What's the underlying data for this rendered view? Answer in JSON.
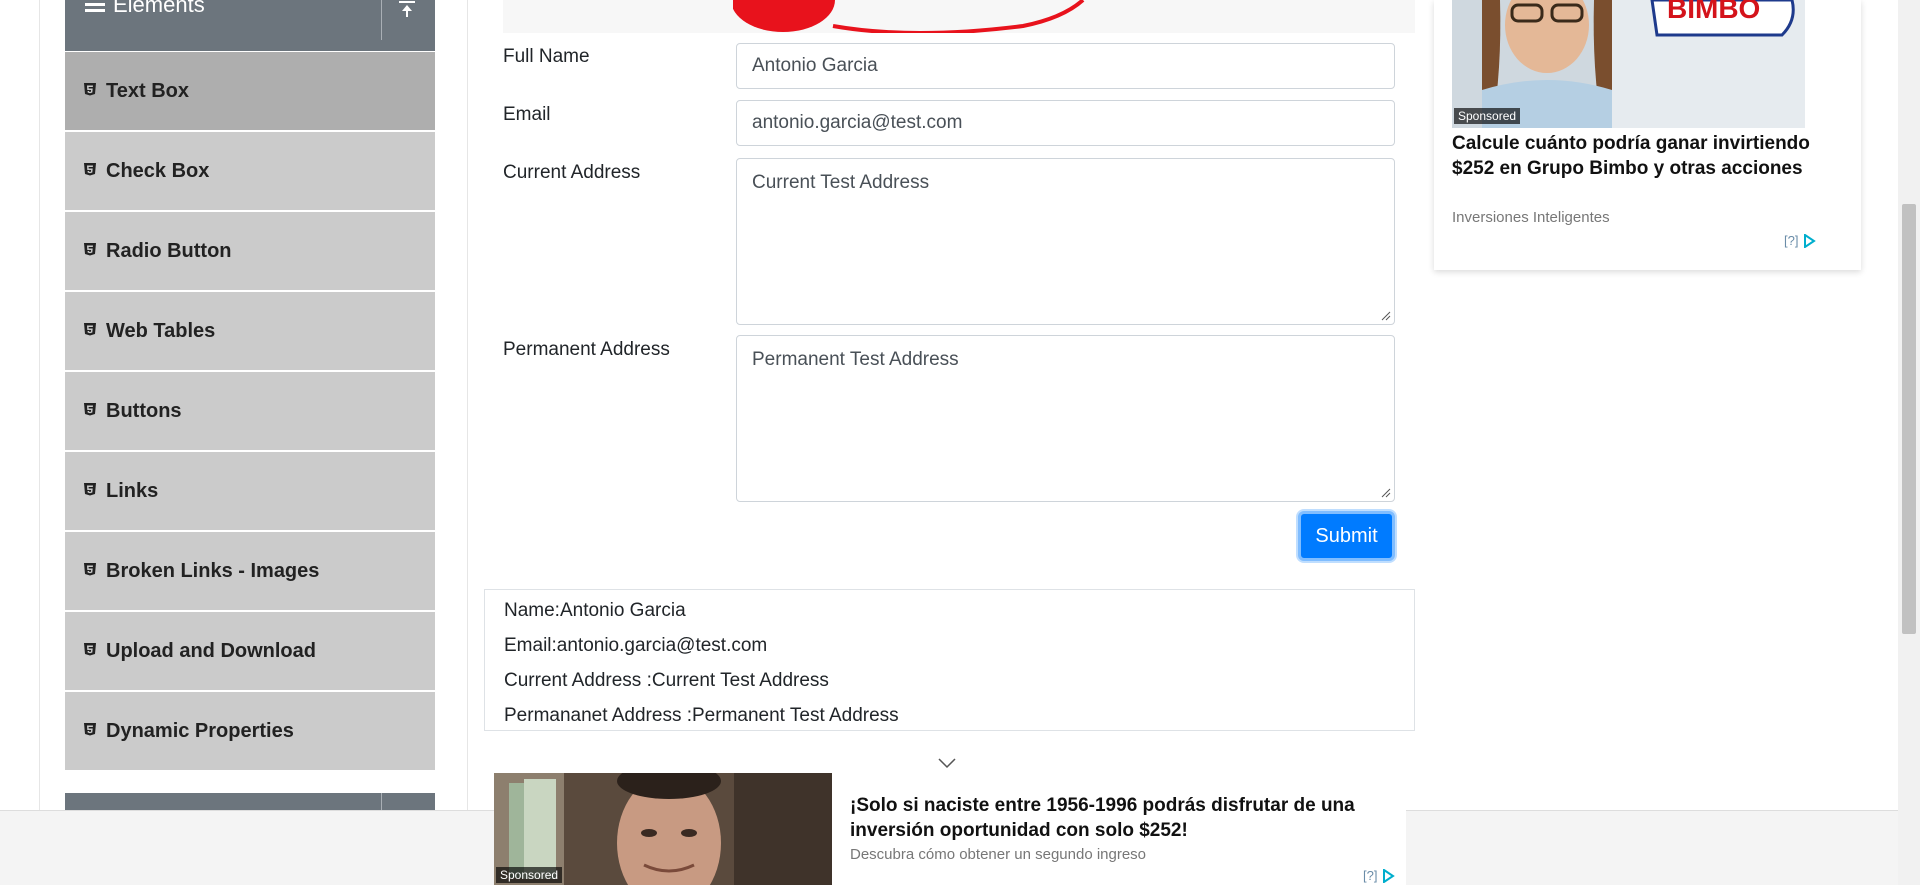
{
  "sidebar": {
    "group_title": "Elements",
    "items": [
      {
        "label": "Text Box",
        "active": true
      },
      {
        "label": "Check Box"
      },
      {
        "label": "Radio Button"
      },
      {
        "label": "Web Tables"
      },
      {
        "label": "Buttons"
      },
      {
        "label": "Links"
      },
      {
        "label": "Broken Links - Images"
      },
      {
        "label": "Upload and Download"
      },
      {
        "label": "Dynamic Properties"
      }
    ]
  },
  "form": {
    "full_name": {
      "label": "Full Name",
      "value": "Antonio Garcia"
    },
    "email": {
      "label": "Email",
      "value": "antonio.garcia@test.com"
    },
    "current_address": {
      "label": "Current Address",
      "value": "Current Test Address"
    },
    "permanent_address": {
      "label": "Permanent Address",
      "value": "Permanent Test Address"
    },
    "submit_label": "Submit"
  },
  "output": {
    "name": "Name:Antonio Garcia",
    "email": "Email:antonio.garcia@test.com",
    "current_address": "Current Address :Current Test Address",
    "permanent_address": "Permananet Address :Permanent Test Address"
  },
  "side_ad": {
    "brand": "BIMBO",
    "badge": "Sponsored",
    "headline": "Calcule cuánto podría ganar invirtiendo $252 en Grupo Bimbo y otras acciones",
    "source": "Inversiones Inteligentes",
    "choices": "[?]"
  },
  "bottom_ad": {
    "badge": "Sponsored",
    "headline": "¡Solo si naciste entre 1956-1996 podrás disfrutar de una inversión oportunidad con solo $252!",
    "source": "Descubra cómo obtener un segundo ingreso",
    "choices": "[?]"
  },
  "colors": {
    "accent": "#007bff",
    "sidebar_header": "#6c757d",
    "sidebar_item": "#cbcbcb",
    "sidebar_item_active": "#aeaeae"
  },
  "icons": [
    "menu-icon",
    "collapse-icon",
    "html5-icon",
    "resize-grip-icon",
    "chevron-down-icon",
    "adchoices-icon"
  ]
}
